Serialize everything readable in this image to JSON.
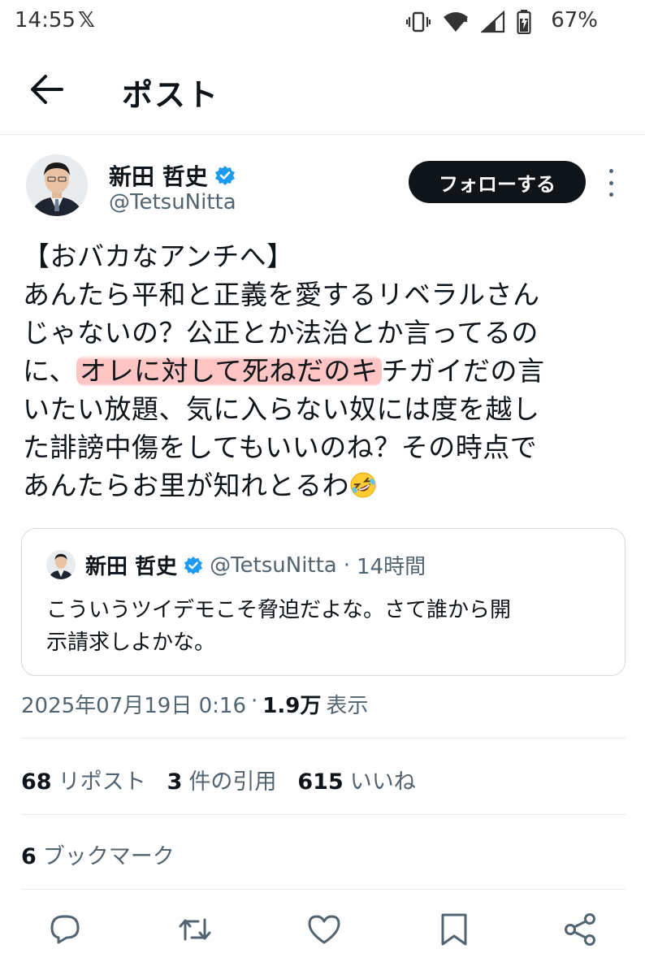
{
  "status_bar": {
    "time": "14:55",
    "app_icon": "x-logo-icon",
    "battery": "67%"
  },
  "header": {
    "title": "ポスト"
  },
  "author": {
    "name": "新田 哲史",
    "handle": "@TetsuNitta",
    "follow_label": "フォローする"
  },
  "tweet": {
    "line1": "【おバカなアンチへ】",
    "line2": "あんたら平和と正義を愛するリベラルさん",
    "line3": "じゃないの？公正とか法治とか言ってるの",
    "line4_pre": "に、",
    "line4_hl": "オレに対して死ねだのキ",
    "line4_post": "チガイだの言",
    "line5": "いたい放題、気に入らない奴には度を越し",
    "line6": "た誹謗中傷をしてもいいのね？その時点で",
    "line7": "あんたらお里が知れとるわ"
  },
  "quote": {
    "name": "新田 哲史",
    "handle": "@TetsuNitta",
    "dot": "·",
    "time": "14時間",
    "text_line1": "こういうツイデモこそ脅迫だよな。さて誰から開",
    "text_line2": "示請求しよかな。"
  },
  "meta": {
    "timestamp": "2025年07月19日 0:16",
    "dot": "·",
    "views_num": "1.9万",
    "views_label": "表示"
  },
  "stats": {
    "reposts_num": "68",
    "reposts_label": "リポスト",
    "quotes_num": "3",
    "quotes_label": "件の引用",
    "likes_num": "615",
    "likes_label": "いいね",
    "bookmarks_num": "6",
    "bookmarks_label": "ブックマーク"
  },
  "colors": {
    "text": "#0f1419",
    "secondary": "#536471",
    "verified": "#1d9bf0",
    "highlight": "#ffb0b0",
    "border": "#cfd9de"
  }
}
